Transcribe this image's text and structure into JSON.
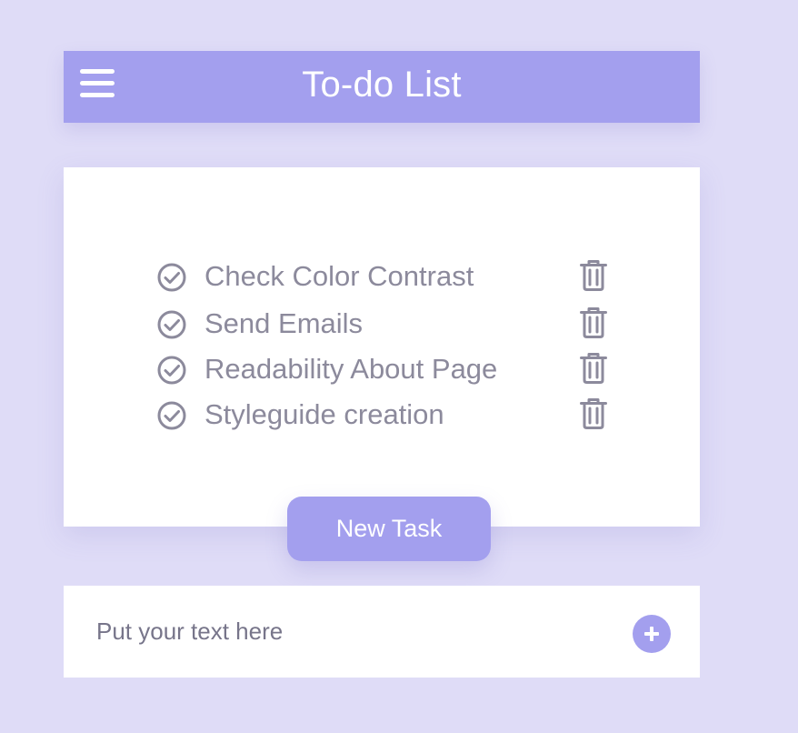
{
  "header": {
    "title": "To-do List",
    "menu_icon": "hamburger-menu-icon",
    "background": "#a39fee"
  },
  "tasks": [
    {
      "label": "Check Color Contrast",
      "status_icon": "check-circle-icon",
      "delete_icon": "trash-icon"
    },
    {
      "label": "Send Emails",
      "status_icon": "check-circle-icon",
      "delete_icon": "trash-icon"
    },
    {
      "label": "Readability About Page",
      "status_icon": "check-circle-icon",
      "delete_icon": "trash-icon"
    },
    {
      "label": "Styleguide creation",
      "status_icon": "check-circle-icon",
      "delete_icon": "trash-icon"
    }
  ],
  "new_task_button": {
    "label": "New Task"
  },
  "input": {
    "value": "",
    "placeholder": "Put your text here",
    "add_icon": "plus-icon"
  },
  "colors": {
    "page_background": "#dfdcf7",
    "accent": "#a39fee",
    "icon_gray": "#8c8a9c"
  }
}
